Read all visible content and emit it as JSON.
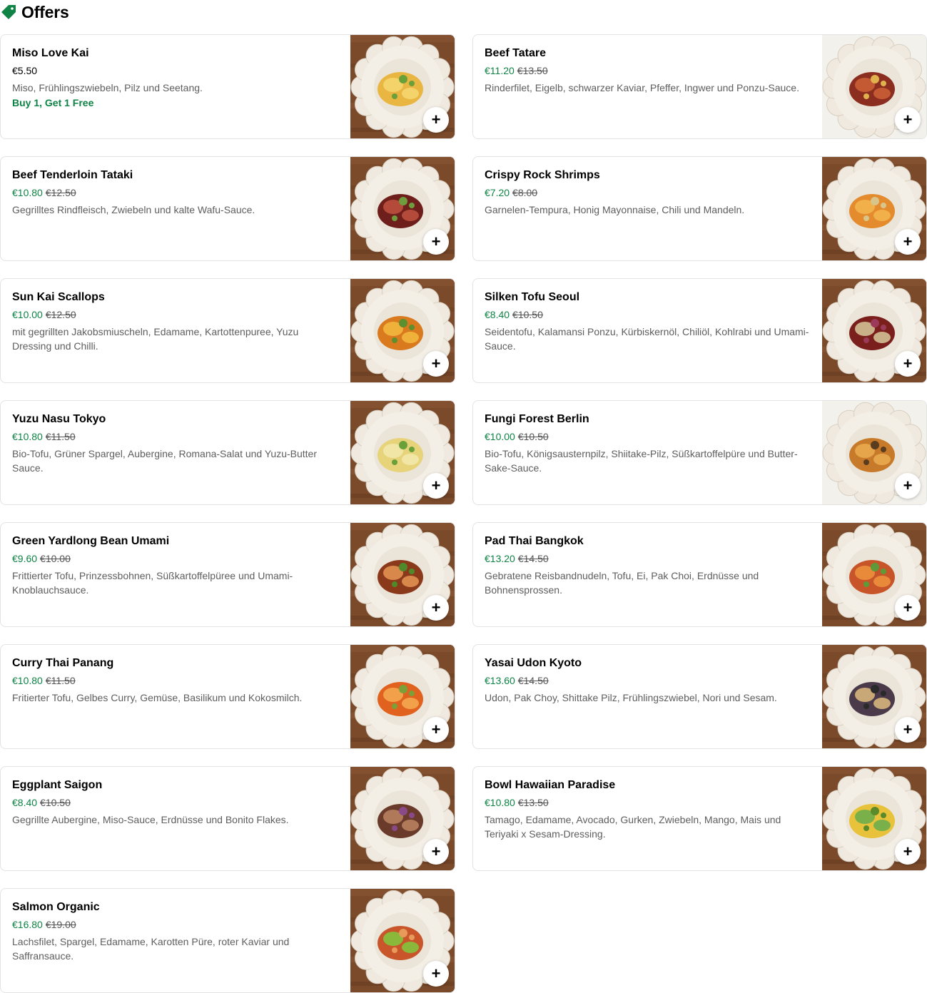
{
  "section": {
    "title": "Offers",
    "icon": "tag-icon",
    "accent": "#0e8345"
  },
  "items": [
    {
      "name": "Miso Love Kai",
      "price": "€5.50",
      "old_price": "",
      "description": "Miso, Frühlingszwiebeln, Pilz und Seetang.",
      "promo": "Buy 1, Get 1 Free",
      "bg": "wood"
    },
    {
      "name": "Beef Tatare",
      "price": "€11.20",
      "old_price": "€13.50",
      "description": "Rinderfilet, Eigelb, schwarzer Kaviar, Pfeffer, Ingwer und Ponzu-Sauce.",
      "promo": "",
      "bg": "light"
    },
    {
      "name": "Beef Tenderloin Tataki",
      "price": "€10.80",
      "old_price": "€12.50",
      "description": "Gegrilltes Rindfleisch, Zwiebeln und kalte Wafu-Sauce.",
      "promo": "",
      "bg": "wood"
    },
    {
      "name": "Crispy Rock Shrimps",
      "price": "€7.20",
      "old_price": "€8.00",
      "description": "Garnelen-Tempura, Honig Mayonnaise, Chili und Mandeln.",
      "promo": "",
      "bg": "wood"
    },
    {
      "name": "Sun Kai Scallops",
      "price": "€10.00",
      "old_price": "€12.50",
      "description": "mit gegrillten Jakobsmiuscheln, Edamame, Kartottenpuree, Yuzu Dressing und Chilli.",
      "promo": "",
      "bg": "wood"
    },
    {
      "name": "Silken Tofu Seoul",
      "price": "€8.40",
      "old_price": "€10.50",
      "description": "Seidentofu, Kalamansi Ponzu, Kürbiskernöl, Chiliöl, Kohlrabi und Umami-Sauce.",
      "promo": "",
      "bg": "wood"
    },
    {
      "name": "Yuzu Nasu Tokyo",
      "price": "€10.80",
      "old_price": "€11.50",
      "description": "Bio-Tofu, Grüner Spargel, Aubergine, Romana-Salat und Yuzu-Butter Sauce.",
      "promo": "",
      "bg": "wood"
    },
    {
      "name": "Fungi Forest Berlin",
      "price": "€10.00",
      "old_price": "€10.50",
      "description": "Bio-Tofu, Königsausternpilz, Shiitake-Pilz, Süßkartoffelpüre und Butter-Sake-Sauce.",
      "promo": "",
      "bg": "light"
    },
    {
      "name": "Green Yardlong Bean Umami",
      "price": "€9.60",
      "old_price": "€10.00",
      "description": "Frittierter Tofu, Prinzessbohnen, Süßkartoffelpüree und Umami-Knoblauchsauce.",
      "promo": "",
      "bg": "wood"
    },
    {
      "name": "Pad Thai Bangkok",
      "price": "€13.20",
      "old_price": "€14.50",
      "description": "Gebratene Reisbandnudeln, Tofu, Ei, Pak Choi, Erdnüsse und Bohnensprossen.",
      "promo": "",
      "bg": "wood"
    },
    {
      "name": "Curry Thai Panang",
      "price": "€10.80",
      "old_price": "€11.50",
      "description": "Fritierter Tofu, Gelbes Curry, Gemüse, Basilikum und Kokosmilch.",
      "promo": "",
      "bg": "wood"
    },
    {
      "name": "Yasai Udon Kyoto",
      "price": "€13.60",
      "old_price": "€14.50",
      "description": "Udon, Pak Choy, Shittake Pilz, Frühlingszwiebel, Nori und Sesam.",
      "promo": "",
      "bg": "wood"
    },
    {
      "name": "Eggplant Saigon",
      "price": "€8.40",
      "old_price": "€10.50",
      "description": "Gegrillte Aubergine, Miso-Sauce, Erdnüsse und Bonito Flakes.",
      "promo": "",
      "bg": "wood"
    },
    {
      "name": "Bowl Hawaiian Paradise",
      "price": "€10.80",
      "old_price": "€13.50",
      "description": "Tamago, Edamame, Avocado, Gurken, Zwiebeln, Mango, Mais und Teriyaki x Sesam-Dressing.",
      "promo": "",
      "bg": "wood"
    },
    {
      "name": "Salmon Organic",
      "price": "€16.80",
      "old_price": "€19.00",
      "description": "Lachsfilet, Spargel, Edamame, Karotten Püre, roter Kaviar und Saffransauce.",
      "promo": "",
      "bg": "wood"
    }
  ],
  "add_button_label": "+",
  "colors": {
    "discount_green": "#0e8345",
    "text_primary": "#000000",
    "text_secondary": "#5e5e5e",
    "border": "#e3e3e3"
  }
}
